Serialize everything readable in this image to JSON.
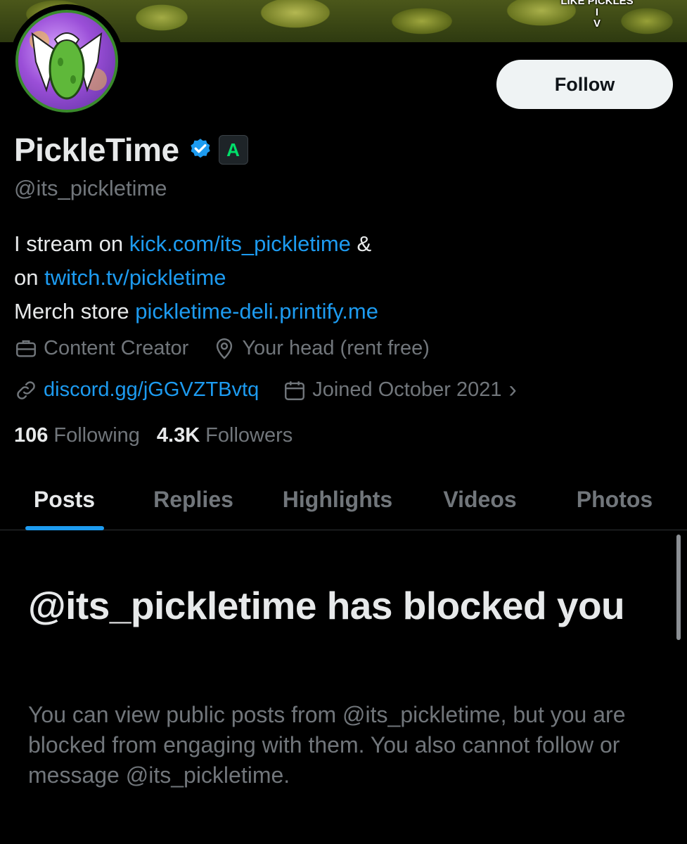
{
  "banner": {
    "caption_line1": "LIKE PICKLES",
    "caption_line2": "I",
    "caption_line3": "V"
  },
  "profile": {
    "display_name": "PickleTime",
    "handle": "@its_pickletime",
    "affiliate_badge_letter": "A",
    "follow_label": "Follow"
  },
  "bio": {
    "line1_prefix": "I stream on ",
    "line1_link": "kick.com/its_pickletime",
    "line1_suffix": " &",
    "line2_prefix": "on ",
    "line2_link": "twitch.tv/pickletime",
    "line3_prefix": "Merch store ",
    "line3_link": "pickletime-deli.printify.me"
  },
  "meta": {
    "category": "Content Creator",
    "location": "Your head (rent free)",
    "website": "discord.gg/jGGVZTBvtq",
    "joined": "Joined October 2021",
    "chevron": "›"
  },
  "counts": {
    "following_value": "106",
    "following_label": "Following",
    "followers_value": "4.3K",
    "followers_label": "Followers"
  },
  "tabs": [
    {
      "label": "Posts"
    },
    {
      "label": "Replies"
    },
    {
      "label": "Highlights"
    },
    {
      "label": "Videos"
    },
    {
      "label": "Photos"
    }
  ],
  "blocked": {
    "title": "@its_pickletime has blocked you",
    "description": "You can view public posts from @its_pickletime, but you are blocked from engaging with them. You also cannot follow or message @its_pickletime."
  },
  "colors": {
    "accent": "#1d9bf0",
    "background": "#000000",
    "text": "#e7e9ea",
    "muted": "#71767b",
    "affiliate_badge": "#00e06a"
  },
  "icons": [
    "verified-badge-icon",
    "briefcase-icon",
    "location-pin-icon",
    "link-icon",
    "calendar-icon",
    "chevron-right-icon"
  ]
}
